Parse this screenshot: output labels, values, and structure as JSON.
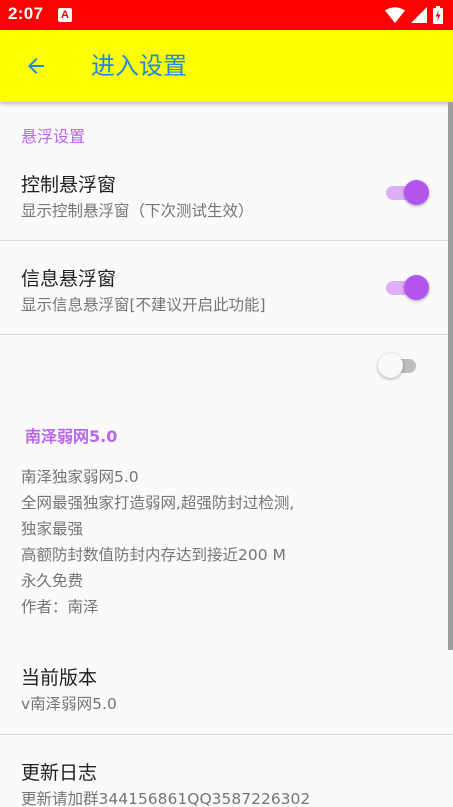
{
  "status_bar": {
    "time": "2:07",
    "notification_letter": "A",
    "background_color": "#ff0000"
  },
  "app_bar": {
    "title": "进入设置",
    "back_icon": "arrow-left-icon",
    "background_color": "#ffff00",
    "title_color": "#1e88e5"
  },
  "settings": {
    "category_title": "悬浮设置",
    "floating_control": {
      "title": "控制悬浮窗",
      "summary": "显示控制悬浮窗（下次测试生效）",
      "enabled": true
    },
    "floating_info": {
      "title": "信息悬浮窗",
      "summary": "显示信息悬浮窗[不建议开启此功能]",
      "enabled": true
    },
    "extra_switch": {
      "enabled": false
    },
    "about": {
      "title": "南泽弱网5.0",
      "lines": [
        "南泽独家弱网5.0",
        "全网最强独家打造弱网,超强防封过检测,",
        "独家最强",
        "高额防封数值防封内存达到接近200 M",
        "永久免费",
        "作者：南泽"
      ]
    },
    "version": {
      "title": "当前版本",
      "summary": "v南泽弱网5.0"
    },
    "changelog": {
      "title": "更新日志",
      "summary": "更新请加群344156861QQ3587226302"
    }
  },
  "colors": {
    "accent": "#b455f0",
    "category_text": "#bb66ee"
  }
}
